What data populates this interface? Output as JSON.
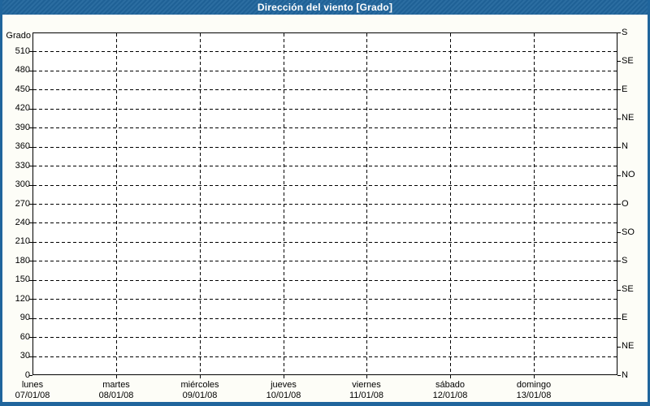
{
  "window": {
    "title": "Dirección del viento [Grado]"
  },
  "colors": {
    "title_bar_bg": "#20659c",
    "title_text": "#ffffff",
    "frame_border": "#20659c",
    "canvas_bg": "#fdfdf7",
    "plot_bg": "#ffffff",
    "axis_color": "#000000",
    "text_color": "#000000"
  },
  "chart_data": {
    "type": "line",
    "title": "Dirección del viento [Grado]",
    "y_left": {
      "label": "Grado",
      "min": 0,
      "max": 540,
      "tick_step": 30,
      "tick_labels": [
        "0",
        "30",
        "60",
        "90",
        "120",
        "150",
        "180",
        "210",
        "240",
        "270",
        "300",
        "330",
        "360",
        "390",
        "420",
        "450",
        "480",
        "510"
      ]
    },
    "y_right": {
      "tick_step": 45,
      "ticks": [
        {
          "deg": 0,
          "label": "N"
        },
        {
          "deg": 45,
          "label": "NE"
        },
        {
          "deg": 90,
          "label": "E"
        },
        {
          "deg": 135,
          "label": "SE"
        },
        {
          "deg": 180,
          "label": "S"
        },
        {
          "deg": 225,
          "label": "SO"
        },
        {
          "deg": 270,
          "label": "O"
        },
        {
          "deg": 315,
          "label": "NO"
        },
        {
          "deg": 360,
          "label": "N"
        },
        {
          "deg": 405,
          "label": "NE"
        },
        {
          "deg": 450,
          "label": "E"
        },
        {
          "deg": 495,
          "label": "SE"
        },
        {
          "deg": 540,
          "label": "S"
        }
      ]
    },
    "x_axis": {
      "days": [
        {
          "name": "lunes",
          "date": "07/01/08"
        },
        {
          "name": "martes",
          "date": "08/01/08"
        },
        {
          "name": "miércoles",
          "date": "09/01/08"
        },
        {
          "name": "jueves",
          "date": "10/01/08"
        },
        {
          "name": "viernes",
          "date": "11/01/08"
        },
        {
          "name": "sábado",
          "date": "12/01/08"
        },
        {
          "name": "domingo",
          "date": "13/01/08"
        }
      ]
    },
    "grid": {
      "h_step_deg": 30,
      "v_per_day": true,
      "style": "dashed",
      "legend": "none"
    },
    "series": []
  }
}
